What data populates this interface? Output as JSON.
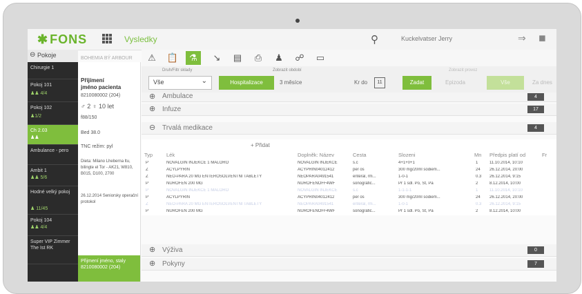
{
  "app": {
    "brand": "FONS",
    "title": "Vysledky",
    "user": "Kuckelvatser Jerry",
    "icons": {
      "brand": "leaf-star-icon",
      "apps": "grid-icon",
      "search": "search-icon",
      "logout": "logout-icon",
      "lock": "lock-icon"
    },
    "accent": "#7fbe3d"
  },
  "sidebar": {
    "header": "Pokoje",
    "items": [
      {
        "label": "Chirurgie 1",
        "sub": ""
      },
      {
        "label": "Pokoj 101",
        "sub": "♟♟ 4/4"
      },
      {
        "label": "Pokoj 102",
        "sub": "♟1/2"
      },
      {
        "label": "Ch 2.03",
        "sub": "♟♟"
      },
      {
        "label": "Ambulance - pero",
        "sub": ""
      },
      {
        "label": "Ambit 1",
        "sub": "♟♟ 5/6"
      },
      {
        "label": "Hodné velký pokoj",
        "sub": "♟ 11/45"
      },
      {
        "label": "Pokoj 104",
        "sub": "♟♟ 4/4"
      },
      {
        "label": "Super VIP Zimmer The Ist RK",
        "sub": ""
      }
    ]
  },
  "patient_col": {
    "line1": "BOHEMIA BÝ ARBOUR",
    "name1": "Přijímení",
    "name2": "jméno pacienta",
    "id": "8210080002 (204)",
    "stats": "♂ 2   ♀ 10 let",
    "hint": "f88/150",
    "bed": "Bed 38.0",
    "tnc": "TNC režim: pyl",
    "diag": "Dieta: Milano Lheberna ltu, bilingte el Tor - AK21, W810, B015, D100, 2700",
    "note": "26.12.2014 Seniorsky operační protokol",
    "box_label": "Přijmení jméno, staly",
    "box_id": "8210080002 (204)"
  },
  "toolbar_icons": [
    "warning-icon",
    "clipboard-icon",
    "lab-flask-icon",
    "syringe-icon",
    "document-icon",
    "printer-icon",
    "group-icon",
    "stethoscope-icon",
    "folder-icon"
  ],
  "filters": {
    "type_caption": "Druh/Filtr sklady",
    "type_value": "Vše",
    "period_caption": "Zobrazit období",
    "period_btn1": "Hospitalizace",
    "period_btn2": "3 měsíce",
    "period_btn3": "Kr do",
    "action_caption": "Zobrazit provoz",
    "apply": "Zadat",
    "btn_a": "Epizoda",
    "btn_b": "Vše",
    "btn_c": "Za dnes"
  },
  "sections": [
    {
      "title": "Ambulace",
      "count": "4"
    },
    {
      "title": "Infuze",
      "count": "17"
    },
    {
      "title": "Trvalá medikace",
      "count": "4"
    }
  ],
  "table": {
    "add_label": "+ Přidat",
    "headers": [
      "Typ",
      "Lék",
      "Doplněk: Název",
      "Cesta",
      "Slozeni",
      "Mn",
      "Předpis platí od",
      "Fr"
    ],
    "rows": [
      {
        "typ": "P",
        "lek": "NOVALGIN INJEKCE 1 MALORO",
        "nazev": "NOVALGIN INJEKCE",
        "cesta": "s.c",
        "slozeni": "4+1+0+1",
        "mn": "1",
        "od": "11.10.2014, 10:10",
        "faint": false
      },
      {
        "typ": "Z",
        "lek": "ACYLPYRIN",
        "nazev": "ACYPRIN04012412",
        "cesta": "per os",
        "slozeni": "300 mg/20ml sodiem...",
        "mn": "24",
        "od": "26.12.2014, 20:00",
        "faint": false
      },
      {
        "typ": "Z",
        "lek": "NEO-PARA 20 MG ENTEROSOLVENTNÍ TABLETY",
        "nazev": "NEOPARA0491541",
        "cesta": "enteral, rm...",
        "slozeni": "1-0-1",
        "mn": "0.3",
        "od": "26.12.2014, 9:15",
        "faint": false
      },
      {
        "typ": "P",
        "lek": "NUROFEN 200 MG",
        "nazev": "NUROFENOFF4WF",
        "cesta": "sonografic...",
        "slozeni": "Pr 1 sdl. Po, St, Pa",
        "mn": "2",
        "od": "8.12.2014, 10:00",
        "faint": false
      },
      {
        "typ": "P",
        "lek": "NOVALGIN INJEKCE 1 MALORO",
        "nazev": "NOVALGIN INJEKCE",
        "cesta": "s.c",
        "slozeni": "1-1-1-1",
        "mn": "1",
        "od": "11.10.2014, 10:10",
        "faint": true
      },
      {
        "typ": "P",
        "lek": "ACYLPYRIN",
        "nazev": "ACYPRIN04012412",
        "cesta": "per os",
        "slozeni": "300 mg/20ml sodiem...",
        "mn": "24",
        "od": "26.12.2014, 20:00",
        "faint": false
      },
      {
        "typ": "Z",
        "lek": "NEO-PARA 20 MG ENTEROSOLVENTNÍ TABLETY",
        "nazev": "NEOPARA0491541",
        "cesta": "enteral, rm...",
        "slozeni": "1-0-1",
        "mn": "0.3",
        "od": "26.12.2014, 9:15",
        "faint": true
      },
      {
        "typ": "P",
        "lek": "NUROFEN 200 MG",
        "nazev": "NUROFENOFF4WF",
        "cesta": "sonografic...",
        "slozeni": "Pr 1 sdl. Po, St, Pa",
        "mn": "2",
        "od": "8.12.2014, 10:00",
        "faint": false
      }
    ]
  },
  "sections_bottom": [
    {
      "title": "Výživa",
      "count": "0"
    },
    {
      "title": "Pokyny",
      "count": "7"
    }
  ]
}
